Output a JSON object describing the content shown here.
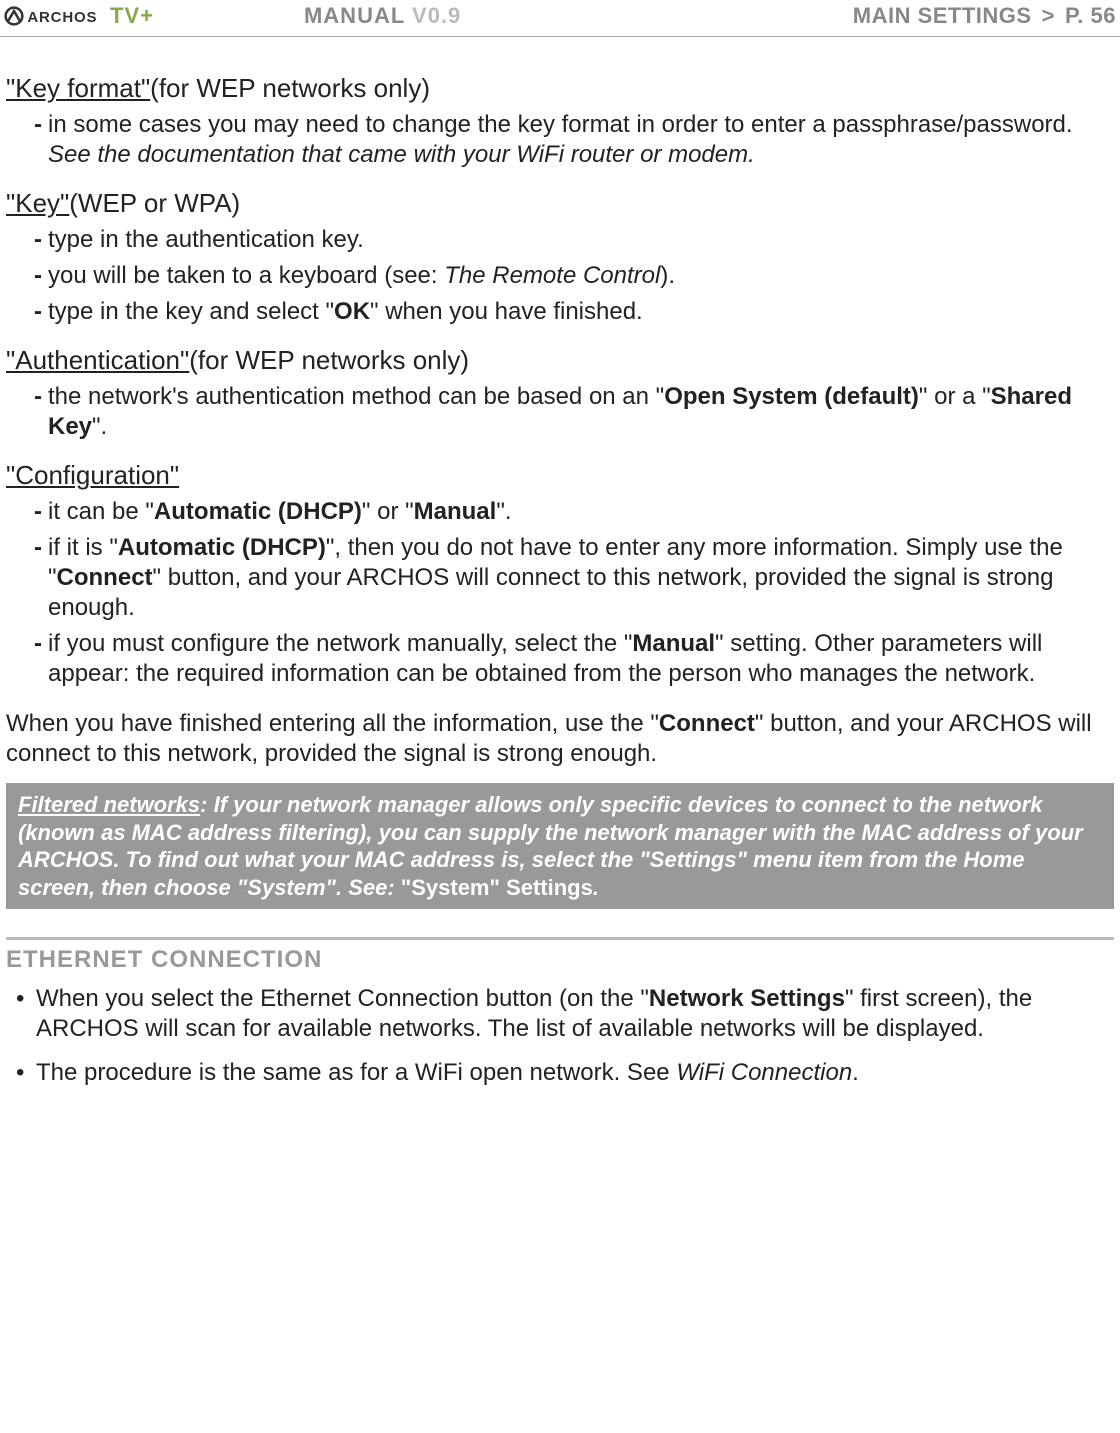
{
  "header": {
    "logo_alt": "ARCHOS",
    "tvplus": "TV+",
    "manual": "MANUAL",
    "version": "V0.9",
    "section": "MAIN SETTINGS",
    "gt": ">",
    "page": "P. 56"
  },
  "sections": {
    "keyformat": {
      "title": "\"Key format\"",
      "paren": " (for WEP networks only)",
      "items": [
        {
          "pre": "in some cases you may need to change the key format in order to enter a passphrase/password. ",
          "italic": "See the documentation that came with your WiFi router or modem."
        }
      ]
    },
    "key": {
      "title": "\"Key\"",
      "paren": " (WEP or WPA)",
      "items": [
        {
          "text": "type in the authentication key."
        },
        {
          "pre": "you will be taken to a keyboard (see: ",
          "italic": "The Remote Control",
          "post": ")."
        },
        {
          "pre": "type in the key and select \"",
          "bold": "OK",
          "post": "\" when you have finished."
        }
      ]
    },
    "auth": {
      "title": "\"Authentication\"",
      "paren": " (for WEP networks only)",
      "items": [
        {
          "pre": "the network's authentication method can be based on an \"",
          "bold": "Open System (default)",
          "mid": "\" or a \"",
          "bold2": "Shared Key",
          "post": "\"."
        }
      ]
    },
    "config": {
      "title": "\"Configuration\"",
      "items": [
        {
          "pre": "it can be \"",
          "bold": "Automatic (DHCP)",
          "mid": "\" or \"",
          "bold2": "Manual",
          "post": "\"."
        },
        {
          "pre": "if it is \"",
          "bold": "Automatic (DHCP)",
          "mid": "\", then you do not have to enter any more information. Simply use the \"",
          "bold2": "Connect",
          "post": "\" button, and your ARCHOS will connect to this network, provided the signal is strong enough."
        },
        {
          "pre": "if you must configure the network manually, select the \"",
          "bold": "Manual",
          "post": "\" setting. Other parameters will appear: the required information can be obtained from the person who manages the network."
        }
      ]
    },
    "finish": {
      "pre": "When you have finished entering all the information, use the \"",
      "bold": "Connect",
      "post": "\" button, and your ARCHOS will connect to this network, provided the signal is strong enough."
    },
    "callout": {
      "title": "Filtered networks",
      "body": ": If your network manager allows only specific devices to connect to the network (known as MAC address filtering), you can supply the network manager with the MAC address of your ARCHOS. To find out what your MAC address is, select the \"Settings\" menu item from the Home screen, then choose \"System\". See: ",
      "link": "\"System\" Settings",
      "end": "."
    },
    "ethernet": {
      "heading": "ETHERNET CONNECTION",
      "items": [
        {
          "pre": "When you select the Ethernet Connection button (on the \"",
          "bold": "Network Settings",
          "post": "\" first screen), the ARCHOS will scan for available networks. The list of available networks will be displayed."
        },
        {
          "pre": "The procedure is the same as for a WiFi open network. See ",
          "italic": "WiFi Connection",
          "post": "."
        }
      ]
    }
  }
}
